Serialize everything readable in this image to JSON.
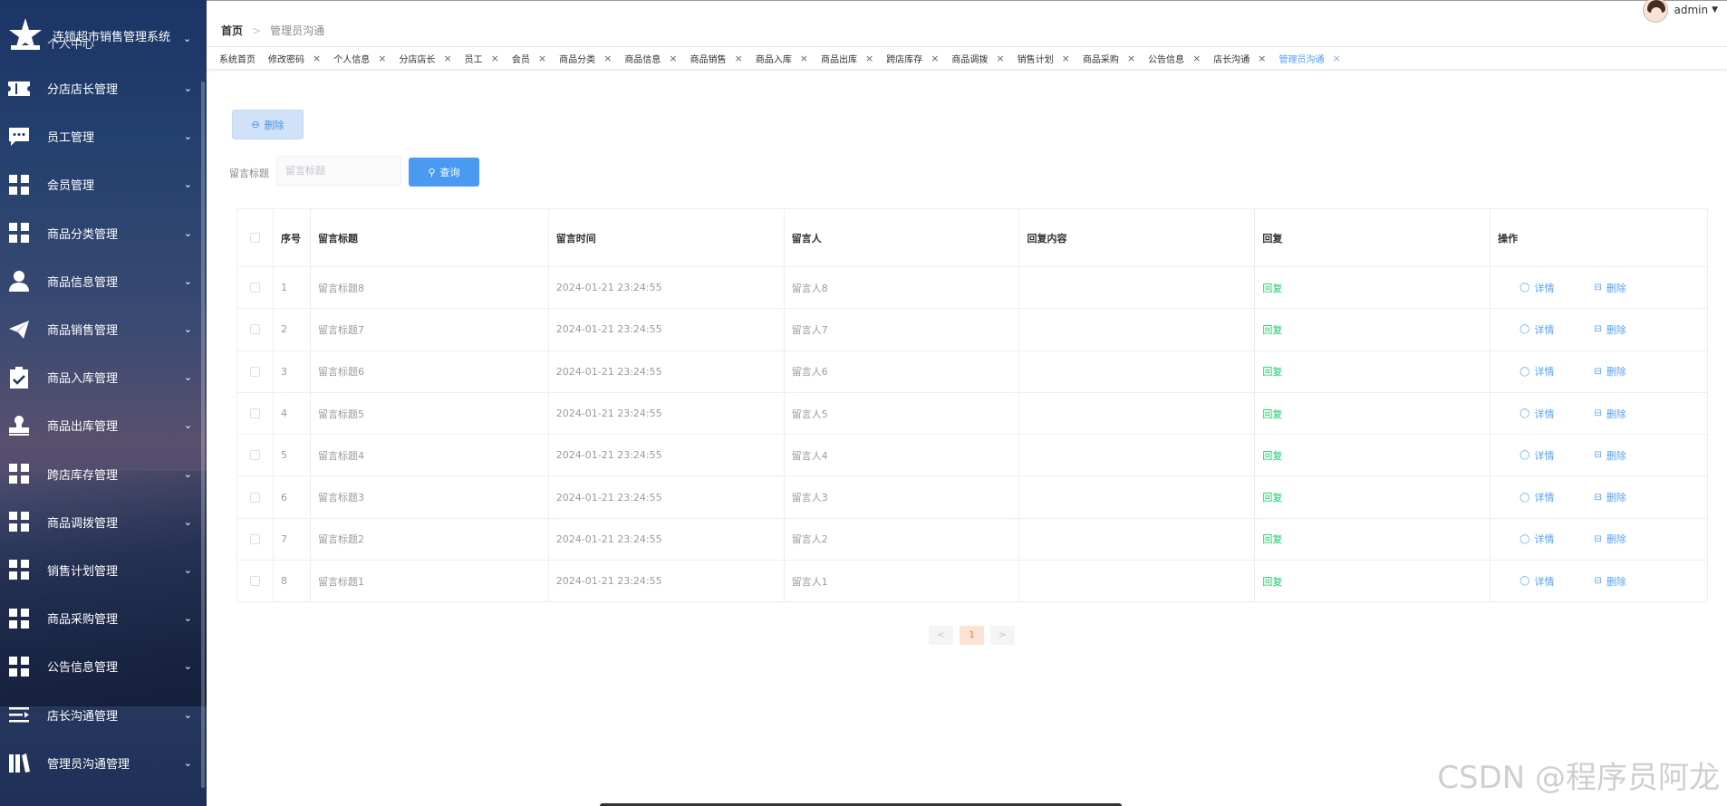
{
  "app": {
    "title": "连锁超市销售管理系统",
    "title_sub": "个人中心"
  },
  "user": {
    "name": "admin"
  },
  "breadcrumb": {
    "home": "首页",
    "current": "管理员沟通"
  },
  "sidebar": {
    "items": [
      {
        "label": "分店店长管理",
        "icon": "ticket-icon"
      },
      {
        "label": "员工管理",
        "icon": "chat-icon"
      },
      {
        "label": "会员管理",
        "icon": "grid-icon"
      },
      {
        "label": "商品分类管理",
        "icon": "grid-icon"
      },
      {
        "label": "商品信息管理",
        "icon": "user-icon"
      },
      {
        "label": "商品销售管理",
        "icon": "paper-plane-icon"
      },
      {
        "label": "商品入库管理",
        "icon": "clipboard-check-icon"
      },
      {
        "label": "商品出库管理",
        "icon": "stamp-icon"
      },
      {
        "label": "跨店库存管理",
        "icon": "grid-icon"
      },
      {
        "label": "商品调拨管理",
        "icon": "grid-icon"
      },
      {
        "label": "销售计划管理",
        "icon": "grid-icon"
      },
      {
        "label": "商品采购管理",
        "icon": "grid-icon"
      },
      {
        "label": "公告信息管理",
        "icon": "grid-icon"
      },
      {
        "label": "店长沟通管理",
        "icon": "list-indent-icon"
      },
      {
        "label": "管理员沟通管理",
        "icon": "books-icon"
      }
    ]
  },
  "tags": [
    {
      "label": "系统首页",
      "closable": false
    },
    {
      "label": "修改密码",
      "closable": true
    },
    {
      "label": "个人信息",
      "closable": true
    },
    {
      "label": "分店店长",
      "closable": true
    },
    {
      "label": "员工",
      "closable": true
    },
    {
      "label": "会员",
      "closable": true
    },
    {
      "label": "商品分类",
      "closable": true
    },
    {
      "label": "商品信息",
      "closable": true
    },
    {
      "label": "商品销售",
      "closable": true
    },
    {
      "label": "商品入库",
      "closable": true
    },
    {
      "label": "商品出库",
      "closable": true
    },
    {
      "label": "跨店库存",
      "closable": true
    },
    {
      "label": "商品调拨",
      "closable": true
    },
    {
      "label": "销售计划",
      "closable": true
    },
    {
      "label": "商品采购",
      "closable": true
    },
    {
      "label": "公告信息",
      "closable": true
    },
    {
      "label": "店长沟通",
      "closable": true
    },
    {
      "label": "管理员沟通",
      "closable": true,
      "active": true
    }
  ],
  "toolbar": {
    "delete_label": "删除"
  },
  "search": {
    "label": "留言标题",
    "placeholder": "留言标题",
    "value": "",
    "button_label": "查询"
  },
  "table": {
    "headers": [
      "序号",
      "留言标题",
      "留言时间",
      "留言人",
      "回复内容",
      "回复",
      "操作"
    ],
    "reply_label": "回复",
    "detail_label": "详情",
    "delete_label": "删除",
    "rows": [
      {
        "index": "1",
        "title": "留言标题8",
        "time": "2024-01-21 23:24:55",
        "user": "留言人8",
        "content": ""
      },
      {
        "index": "2",
        "title": "留言标题7",
        "time": "2024-01-21 23:24:55",
        "user": "留言人7",
        "content": ""
      },
      {
        "index": "3",
        "title": "留言标题6",
        "time": "2024-01-21 23:24:55",
        "user": "留言人6",
        "content": ""
      },
      {
        "index": "4",
        "title": "留言标题5",
        "time": "2024-01-21 23:24:55",
        "user": "留言人5",
        "content": ""
      },
      {
        "index": "5",
        "title": "留言标题4",
        "time": "2024-01-21 23:24:55",
        "user": "留言人4",
        "content": ""
      },
      {
        "index": "6",
        "title": "留言标题3",
        "time": "2024-01-21 23:24:55",
        "user": "留言人3",
        "content": ""
      },
      {
        "index": "7",
        "title": "留言标题2",
        "time": "2024-01-21 23:24:55",
        "user": "留言人2",
        "content": ""
      },
      {
        "index": "8",
        "title": "留言标题1",
        "time": "2024-01-21 23:24:55",
        "user": "留言人1",
        "content": ""
      }
    ]
  },
  "pagination": {
    "prev": "<",
    "current": "1",
    "next": ">"
  },
  "watermark": "CSDN @程序员阿龙",
  "colors": {
    "primary": "#4a9af1",
    "success": "#13ce66",
    "sidebar": "#1b3566"
  }
}
